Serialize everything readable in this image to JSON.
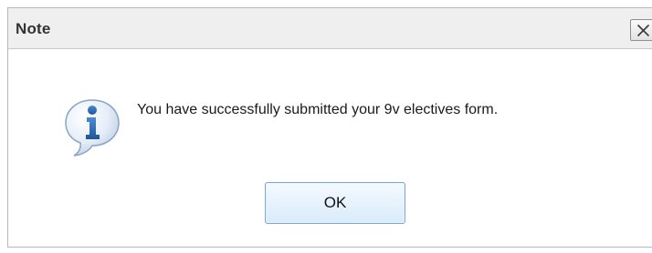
{
  "dialog": {
    "title": "Note",
    "close_icon": "close-icon",
    "message_icon": "info-icon",
    "message": "You have successfully submitted your 9v electives form.",
    "ok_label": "OK"
  },
  "colors": {
    "titlebar_bg": "#efefef",
    "button_border": "#7aa7d6",
    "icon_blue": "#2f6db3"
  }
}
